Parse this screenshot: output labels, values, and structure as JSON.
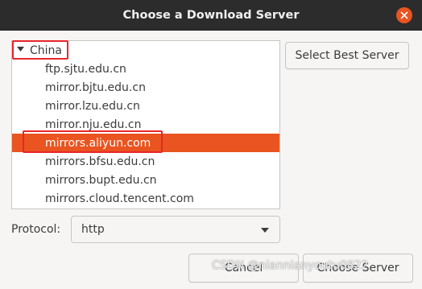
{
  "dialog": {
    "title": "Choose a Download Server"
  },
  "server_list": {
    "group_label": "China",
    "group_expanded": true,
    "servers": [
      "ftp.sjtu.edu.cn",
      "mirror.bjtu.edu.cn",
      "mirror.lzu.edu.cn",
      "mirror.nju.edu.cn",
      "mirrors.aliyun.com",
      "mirrors.bfsu.edu.cn",
      "mirrors.bupt.edu.cn",
      "mirrors.cloud.tencent.com"
    ],
    "selected_server": "mirrors.aliyun.com"
  },
  "buttons": {
    "select_best": "Select Best Server",
    "cancel": "Cancel",
    "choose": "Choose Server"
  },
  "protocol": {
    "label": "Protocol:",
    "value": "http"
  },
  "watermark": "CSDN @niannianyoutu0822",
  "colors": {
    "titlebar": "#2c2c2c",
    "accent": "#e95420",
    "annotation_box": "#e8262a"
  },
  "icons": {
    "close": "close-icon",
    "expander": "triangle-down-icon",
    "combo": "chevron-down-icon"
  }
}
